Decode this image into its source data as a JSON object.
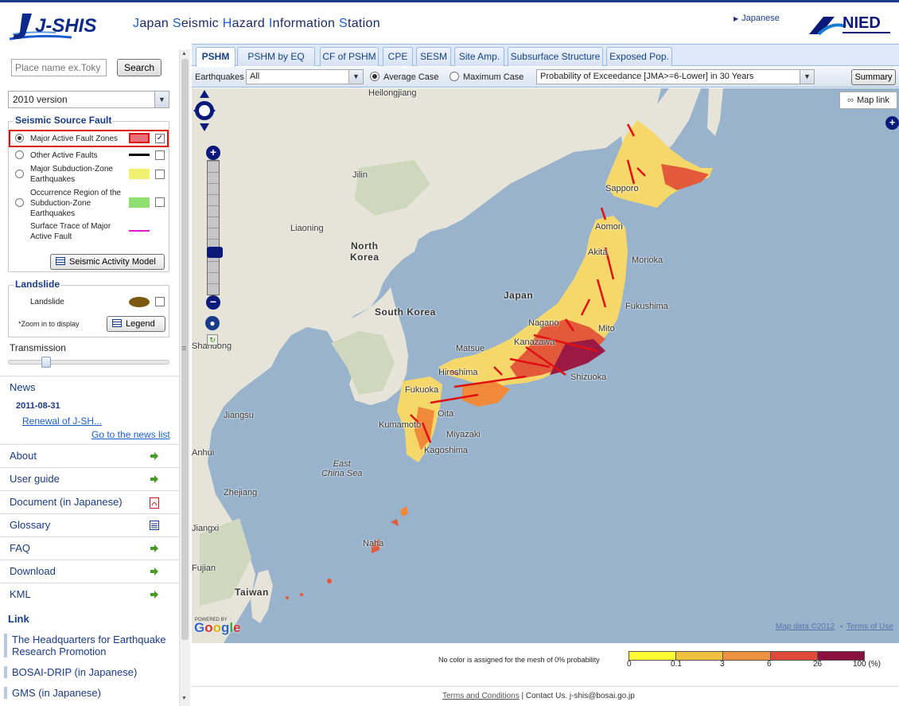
{
  "header": {
    "logo_text": "J-SHIS",
    "title_parts": [
      {
        "initial": "J",
        "rest": "apan "
      },
      {
        "initial": "S",
        "rest": "eismic "
      },
      {
        "initial": "H",
        "rest": "azard "
      },
      {
        "initial": "I",
        "rest": "nformation "
      },
      {
        "initial": "S",
        "rest": "tation"
      }
    ],
    "language_link": "Japanese",
    "org_logo_text": "NIED"
  },
  "sidebar": {
    "search": {
      "placeholder": "Place name ex.Toky",
      "button": "Search"
    },
    "version": "2010 version",
    "fault_section": {
      "title": "Seismic Source Fault",
      "layers": [
        {
          "label": "Major Active Fault Zones",
          "selected": true,
          "checked": true,
          "swatch": "#e8707a"
        },
        {
          "label": "Other Active Faults",
          "selected": false,
          "checked": false,
          "swatch": "#000000"
        },
        {
          "label": "Major Subduction-Zone Earthquakes",
          "selected": false,
          "checked": false,
          "swatch": "#f0f070"
        },
        {
          "label": "Occurrence Region of the Subduction-Zone Earthquakes",
          "selected": false,
          "checked": false,
          "swatch": "#90e070"
        },
        {
          "label": "Surface Trace of Major Active Fault",
          "swatch": "#e020d0"
        }
      ],
      "model_button": "Seismic Activity Model"
    },
    "landslide_section": {
      "title": "Landslide",
      "label": "Landslide",
      "swatch": "#7a5a10",
      "note": "*Zoom in to display",
      "legend_button": "Legend"
    },
    "transmission_label": "Transmission",
    "news": {
      "title": "News",
      "date": "2011-08-31",
      "item": "Renewal of J-SH...",
      "all_link": "Go to the news list"
    },
    "menu": [
      {
        "label": "About",
        "icon": "arrow-right-icon"
      },
      {
        "label": "User guide",
        "icon": "arrow-right-icon"
      },
      {
        "label": "Document (in Japanese)",
        "icon": "pdf-icon"
      },
      {
        "label": "Glossary",
        "icon": "list-icon"
      },
      {
        "label": "FAQ",
        "icon": "arrow-right-icon"
      },
      {
        "label": "Download",
        "icon": "arrow-right-icon"
      },
      {
        "label": "KML",
        "icon": "arrow-right-icon"
      }
    ],
    "link_heading": "Link",
    "links": [
      {
        "label": "The Headquarters for Earthquake Research Promotion"
      },
      {
        "label": "BOSAI-DRIP (in Japanese)"
      },
      {
        "label": "GMS (in Japanese)"
      }
    ]
  },
  "tabs": [
    {
      "label": "PSHM",
      "active": true
    },
    {
      "label": "PSHM by EQ Cat."
    },
    {
      "label": "CF of PSHM"
    },
    {
      "label": "CPE"
    },
    {
      "label": "SESM"
    },
    {
      "label": "Site Amp."
    },
    {
      "label": "Subsurface Structure"
    },
    {
      "label": "Exposed Pop."
    }
  ],
  "toolbar": {
    "earthquakes_label": "Earthquakes",
    "earthquakes_value": "All",
    "average_case": "Average Case",
    "maximum_case": "Maximum Case",
    "selected_case": "Average Case",
    "probability_value": "Probability of Exceedance [JMA>=6-Lower] in 30 Years",
    "summary_button": "Summary"
  },
  "map": {
    "map_link": "Map link",
    "places": [
      {
        "name": "Heilongjiang"
      },
      {
        "name": "Jilin"
      },
      {
        "name": "Liaoning"
      },
      {
        "name": "North\nKorea",
        "bold": true
      },
      {
        "name": "South Korea",
        "bold": true
      },
      {
        "name": "Japan",
        "bold": true
      },
      {
        "name": "Sapporo"
      },
      {
        "name": "Aomori"
      },
      {
        "name": "Morioka"
      },
      {
        "name": "Akita"
      },
      {
        "name": "Fukushima"
      },
      {
        "name": "Nagano"
      },
      {
        "name": "Mito"
      },
      {
        "name": "Kanazawa"
      },
      {
        "name": "Shizuoka"
      },
      {
        "name": "Matsue"
      },
      {
        "name": "Hiroshima"
      },
      {
        "name": "Fukuoka"
      },
      {
        "name": "Oita"
      },
      {
        "name": "Kumamoto"
      },
      {
        "name": "Miyazaki"
      },
      {
        "name": "Kagoshima"
      },
      {
        "name": "Naha"
      },
      {
        "name": "Shandong"
      },
      {
        "name": "Jiangsu"
      },
      {
        "name": "Anhui"
      },
      {
        "name": "Zhejiang"
      },
      {
        "name": "Jiangxi"
      },
      {
        "name": "Fujian"
      },
      {
        "name": "East\nChina Sea",
        "italic": true
      },
      {
        "name": "Taiwan",
        "bold": true
      }
    ],
    "powered_by": "POWERED BY",
    "google": "Google",
    "map_data": "Map data ©2012",
    "terms_of_use": "Terms of Use"
  },
  "legend": {
    "note": "No color is assigned for the mesh of 0% probability",
    "colors": [
      "#ffff33",
      "#f0c040",
      "#f09040",
      "#e04838",
      "#8a1040"
    ],
    "ticks": [
      "0",
      "0.1",
      "3",
      "6",
      "26",
      "100 (%)"
    ]
  },
  "footer": {
    "terms": "Terms and Conditions",
    "separator": " | ",
    "contact": "Contact Us.",
    "email": "j-shis@bosai.go.jp"
  }
}
